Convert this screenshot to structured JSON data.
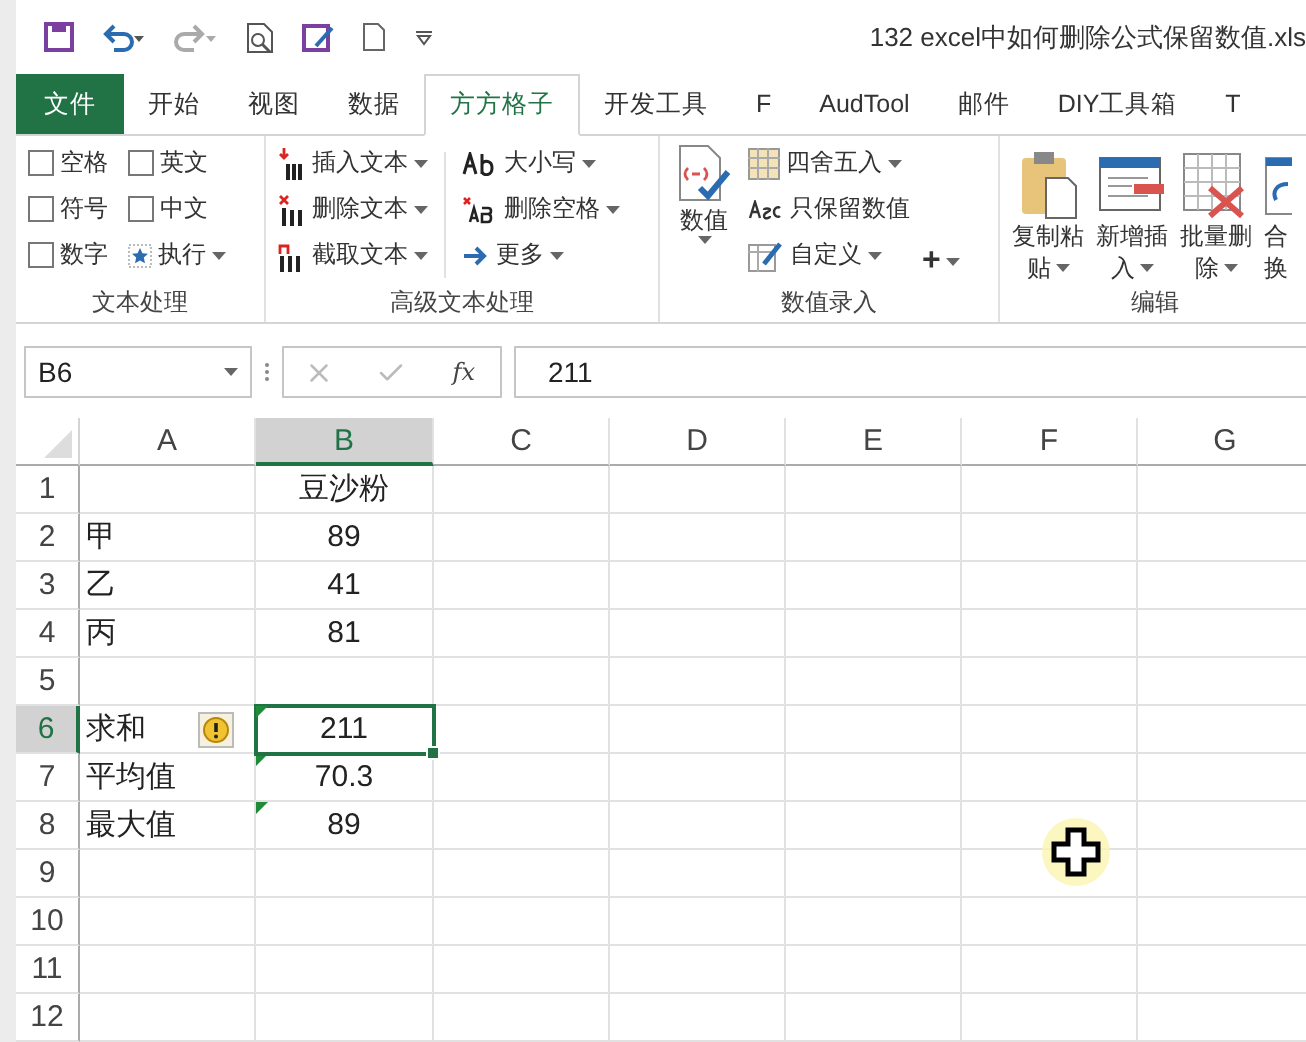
{
  "title_bar": {
    "title": "132 excel中如何删除公式保留数值.xls"
  },
  "tabs": [
    {
      "label": "文件",
      "kind": "file",
      "selected": false
    },
    {
      "label": "开始",
      "kind": "tab",
      "selected": false
    },
    {
      "label": "视图",
      "kind": "tab",
      "selected": false
    },
    {
      "label": "数据",
      "kind": "tab",
      "selected": false
    },
    {
      "label": "方方格子",
      "kind": "tab",
      "selected": true
    },
    {
      "label": "开发工具",
      "kind": "tab",
      "selected": false
    },
    {
      "label": "F",
      "kind": "tab",
      "selected": false
    },
    {
      "label": "AudTool",
      "kind": "tab",
      "selected": false
    },
    {
      "label": "邮件",
      "kind": "tab",
      "selected": false
    },
    {
      "label": "DIY工具箱",
      "kind": "tab",
      "selected": false
    },
    {
      "label": "T",
      "kind": "tab",
      "selected": false
    }
  ],
  "ribbon": {
    "text_group": {
      "label": "文本处理",
      "checkboxes": [
        {
          "label": "空格",
          "checked": false
        },
        {
          "label": "英文",
          "checked": false
        },
        {
          "label": "符号",
          "checked": false
        },
        {
          "label": "中文",
          "checked": false
        },
        {
          "label": "数字",
          "checked": false
        }
      ],
      "run_button": "执行"
    },
    "advanced_group": {
      "label": "高级文本处理",
      "buttons": [
        {
          "label": "插入文本"
        },
        {
          "label": "删除文本"
        },
        {
          "label": "截取文本"
        },
        {
          "label": "大小写"
        },
        {
          "label": "删除空格"
        },
        {
          "label": "更多"
        }
      ]
    },
    "number_group": {
      "label": "数值录入",
      "big_button": "数值",
      "buttons": [
        {
          "label": "四舍五入",
          "dropdown": true
        },
        {
          "label": "只保留数值",
          "dropdown": false
        },
        {
          "label": "自定义",
          "dropdown": true
        }
      ],
      "plus_button": "+"
    },
    "edit_group": {
      "label": "编辑",
      "buttons": [
        {
          "lines": [
            "复制粘",
            "贴"
          ]
        },
        {
          "lines": [
            "新增插",
            "入"
          ]
        },
        {
          "lines": [
            "批量删",
            "除"
          ]
        },
        {
          "lines": [
            "合",
            "换"
          ]
        }
      ]
    }
  },
  "formula_bar": {
    "name_box": "B6",
    "function_button": "fx",
    "formula": "211"
  },
  "sheet": {
    "columns": [
      {
        "label": "A",
        "selected": false
      },
      {
        "label": "B",
        "selected": true
      },
      {
        "label": "C",
        "selected": false
      },
      {
        "label": "D",
        "selected": false
      },
      {
        "label": "E",
        "selected": false
      },
      {
        "label": "F",
        "selected": false
      },
      {
        "label": "G",
        "selected": false
      }
    ],
    "rows": [
      {
        "label": "1",
        "selected": false,
        "cells": {
          "B": {
            "text": "豆沙粉"
          }
        }
      },
      {
        "label": "2",
        "selected": false,
        "cells": {
          "A": {
            "text": "甲"
          },
          "B": {
            "text": "89"
          }
        }
      },
      {
        "label": "3",
        "selected": false,
        "cells": {
          "A": {
            "text": "乙"
          },
          "B": {
            "text": "41"
          }
        }
      },
      {
        "label": "4",
        "selected": false,
        "cells": {
          "A": {
            "text": "丙"
          },
          "B": {
            "text": "81"
          }
        }
      },
      {
        "label": "5",
        "selected": false,
        "cells": {}
      },
      {
        "label": "6",
        "selected": true,
        "cells": {
          "A": {
            "text": "求和",
            "warning": true
          },
          "B": {
            "text": "211",
            "flag": true,
            "active": true
          }
        }
      },
      {
        "label": "7",
        "selected": false,
        "cells": {
          "A": {
            "text": "平均值"
          },
          "B": {
            "text": "70.3",
            "flag": true
          }
        }
      },
      {
        "label": "8",
        "selected": false,
        "cells": {
          "A": {
            "text": "最大值"
          },
          "B": {
            "text": "89",
            "flag": true
          }
        }
      },
      {
        "label": "9",
        "selected": false,
        "cells": {}
      },
      {
        "label": "10",
        "selected": false,
        "cells": {}
      },
      {
        "label": "11",
        "selected": false,
        "cells": {}
      },
      {
        "label": "12",
        "selected": false,
        "cells": {}
      }
    ]
  }
}
